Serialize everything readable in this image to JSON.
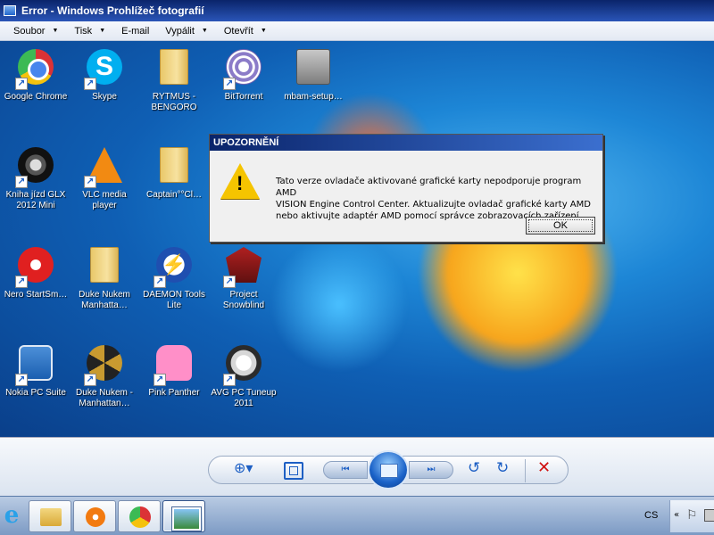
{
  "window": {
    "title": "Error - Windows Prohlížeč fotografií"
  },
  "menu": [
    {
      "label": "Soubor",
      "dropdown": true
    },
    {
      "label": "Tisk",
      "dropdown": true
    },
    {
      "label": "E-mail",
      "dropdown": false
    },
    {
      "label": "Vypálit",
      "dropdown": true
    },
    {
      "label": "Otevřít",
      "dropdown": true
    }
  ],
  "desktop_icons": [
    {
      "label": "Google Chrome",
      "icon": "chrome-icon",
      "shortcut": true
    },
    {
      "label": "Skype",
      "icon": "skype-icon",
      "shortcut": true
    },
    {
      "label": "RYTMUS - BENGORO",
      "icon": "folder-icon",
      "shortcut": false
    },
    {
      "label": "BitTorrent",
      "icon": "bittorrent-icon",
      "shortcut": true
    },
    {
      "label": "mbam-setup…",
      "icon": "setup-icon",
      "shortcut": false
    },
    {
      "label": "Kniha jízd GLX 2012 Mini",
      "icon": "tire-icon",
      "shortcut": true
    },
    {
      "label": "VLC media player",
      "icon": "vlc-icon",
      "shortcut": true
    },
    {
      "label": "Captain°°Cl…",
      "icon": "folder-icon",
      "shortcut": false
    },
    {
      "label": "Nero StartSm…",
      "icon": "nero-icon",
      "shortcut": true
    },
    {
      "label": "Duke Nukem Manhatta…",
      "icon": "folder-icon",
      "shortcut": false
    },
    {
      "label": "DAEMON Tools Lite",
      "icon": "daemon-tools-icon",
      "shortcut": true
    },
    {
      "label": "Project Snowblind",
      "icon": "snowblind-icon",
      "shortcut": true
    },
    {
      "label": "Nokia PC Suite",
      "icon": "nokia-icon",
      "shortcut": true
    },
    {
      "label": "Duke Nukem - Manhattan…",
      "icon": "duke-nukem-icon",
      "shortcut": true
    },
    {
      "label": "Pink Panther",
      "icon": "pink-panther-icon",
      "shortcut": true
    },
    {
      "label": "AVG PC Tuneup 2011",
      "icon": "avg-icon",
      "shortcut": true
    }
  ],
  "dialog": {
    "title": "UPOZORNĚNÍ",
    "message_line1": "Tato verze ovladače aktivované grafické karty nepodporuje program AMD",
    "message_line2": "VISION Engine Control Center. Aktualizujte ovladač grafické karty AMD",
    "message_line3": "nebo aktivujte adaptér AMD pomocí správce zobrazovacích zařízení.",
    "ok_label": "OK",
    "icon": "warning-icon"
  },
  "controls": {
    "zoom_glyph": "⊕▾",
    "prev_glyph": "⏮",
    "next_glyph": "⏭",
    "rotate_left_glyph": "↺",
    "rotate_right_glyph": "↻",
    "delete_glyph": "✕"
  },
  "taskbar": {
    "language": "CS",
    "ie_glyph": "e",
    "tray_chevron": "«",
    "tray_flag": "⚐"
  },
  "colors": {
    "titlebar": "#0a246a",
    "accent": "#1d5fc4",
    "warning": "#f5c400",
    "delete": "#d01010"
  }
}
